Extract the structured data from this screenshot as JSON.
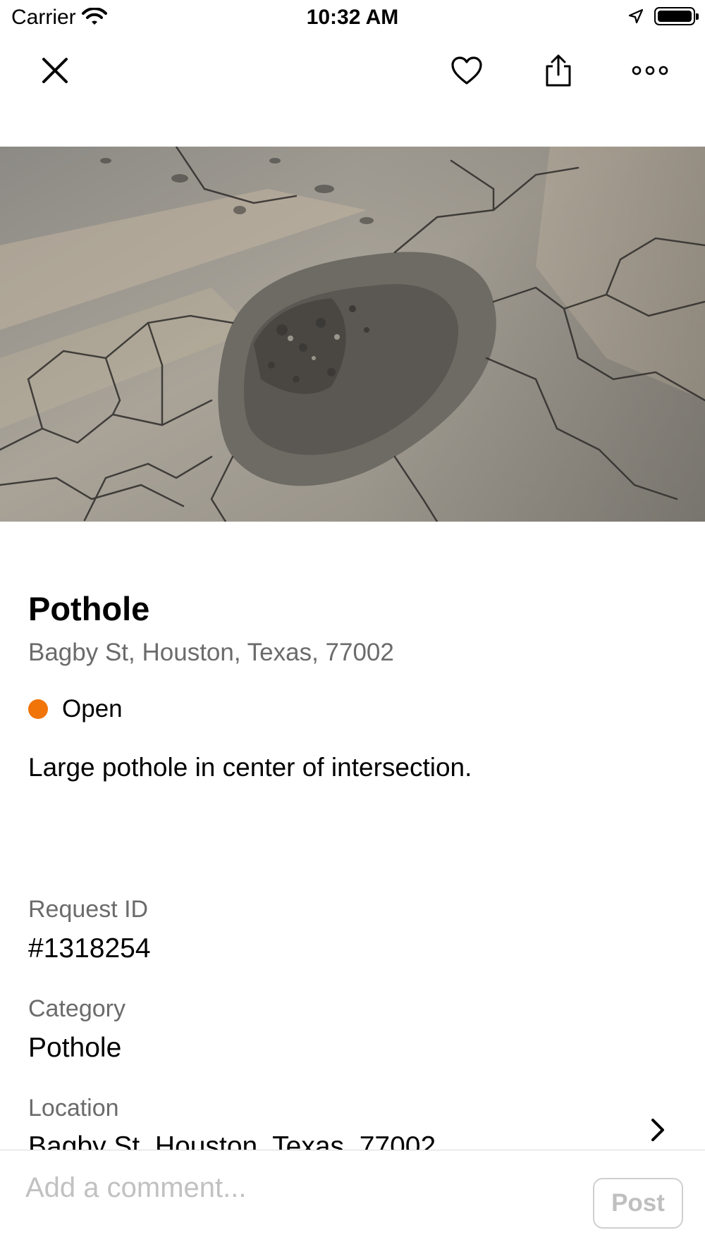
{
  "status_bar": {
    "carrier": "Carrier",
    "time": "10:32 AM"
  },
  "nav": {
    "icons": [
      "close-icon",
      "heart-icon",
      "share-icon",
      "more-icon"
    ]
  },
  "request": {
    "title": "Pothole",
    "address": "Bagby St, Houston, Texas, 77002",
    "status": "Open",
    "status_color": "#f07408",
    "description": "Large pothole in center of intersection."
  },
  "details": {
    "request_id_label": "Request ID",
    "request_id_value": "#1318254",
    "category_label": "Category",
    "category_value": "Pothole",
    "location_label": "Location",
    "location_value": "Bagby St, Houston, Texas, 77002"
  },
  "comment": {
    "placeholder": "Add a comment...",
    "post_label": "Post"
  }
}
